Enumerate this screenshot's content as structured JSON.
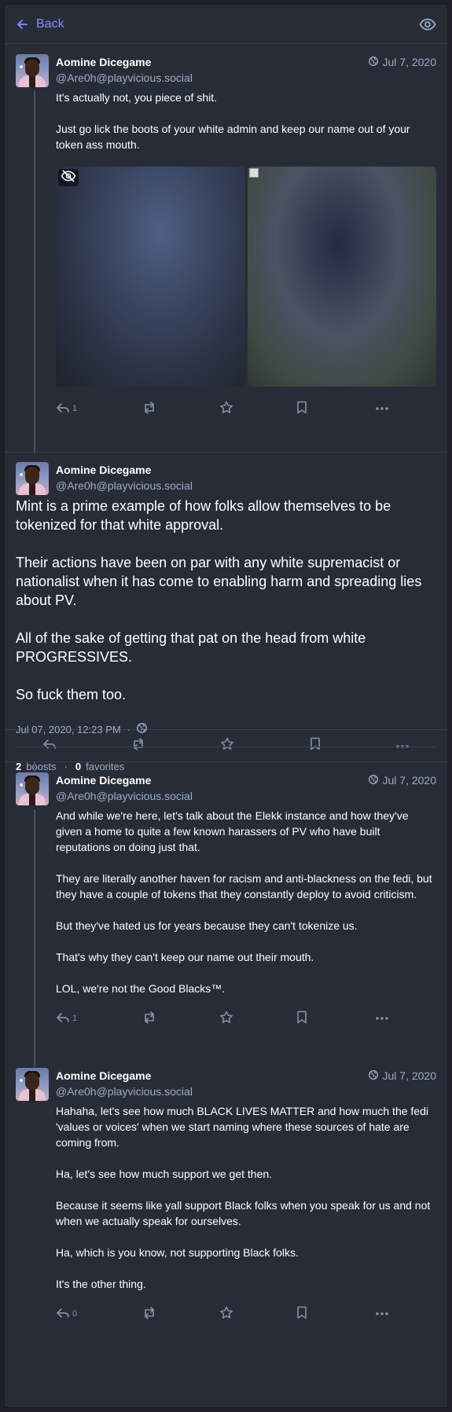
{
  "colors": {
    "accent": "#8c8dff",
    "secondary": "#9baec8",
    "icon": "#8591a6",
    "background": "#282c37"
  },
  "header": {
    "back_label": "Back",
    "back_icon": "arrow-left-icon",
    "visibility_icon": "eye-icon"
  },
  "author": {
    "display_name": "Aomine Dicegame",
    "acct": "@Are0h@playvicious.social"
  },
  "statuses": [
    {
      "time": "Jul 7, 2020",
      "paragraphs": [
        "It's actually not, you piece of shit.",
        "Just go lick the boots of your white admin and keep our name out of your token ass mouth."
      ],
      "reply_count": "1",
      "media": [
        "hidden-media-1",
        "broken-image-2"
      ]
    },
    {
      "time": "Jul 7, 2020",
      "paragraphs": [
        "And while we're here, let's talk about the Elekk instance and how they've given a home to quite a few known harassers of PV who have built reputations on doing just that.",
        "They are literally another haven for racism and anti-blackness on the fedi, but they have a couple of tokens that they constantly deploy to avoid criticism.",
        "But they've hated us for years because they can't tokenize us.",
        "That's why they can't keep our name out their mouth.",
        "LOL, we're not the Good Blacks™."
      ],
      "reply_count": "1"
    },
    {
      "time": "Jul 7, 2020",
      "paragraphs": [
        "Hahaha, let's see how much BLACK LIVES MATTER and how much the fedi 'values or voices' when we start naming where these sources of hate are coming from.",
        "Ha, let's see how much support we get then.",
        "Because it seems like yall support Black folks when you speak for us and not when we actually speak for ourselves.",
        "Ha, which is you know, not supporting Black folks.",
        "It's the other thing."
      ],
      "reply_count": "0"
    }
  ],
  "focused": {
    "paragraphs": [
      "Mint is a prime example of how folks allow themselves to be tokenized for that white approval.",
      "Their actions have been on par with any white supremacist or nationalist when it has come to enabling harm and spreading lies about PV.",
      "All of the sake of getting that pat on the head from white PROGRESSIVES.",
      "So fuck them too."
    ],
    "timestamp": "Jul 07, 2020, 12:23 PM",
    "separator": "·",
    "boosts_count": "2",
    "boosts_label": "boosts",
    "favorites_count": "0",
    "favorites_label": "favorites"
  }
}
